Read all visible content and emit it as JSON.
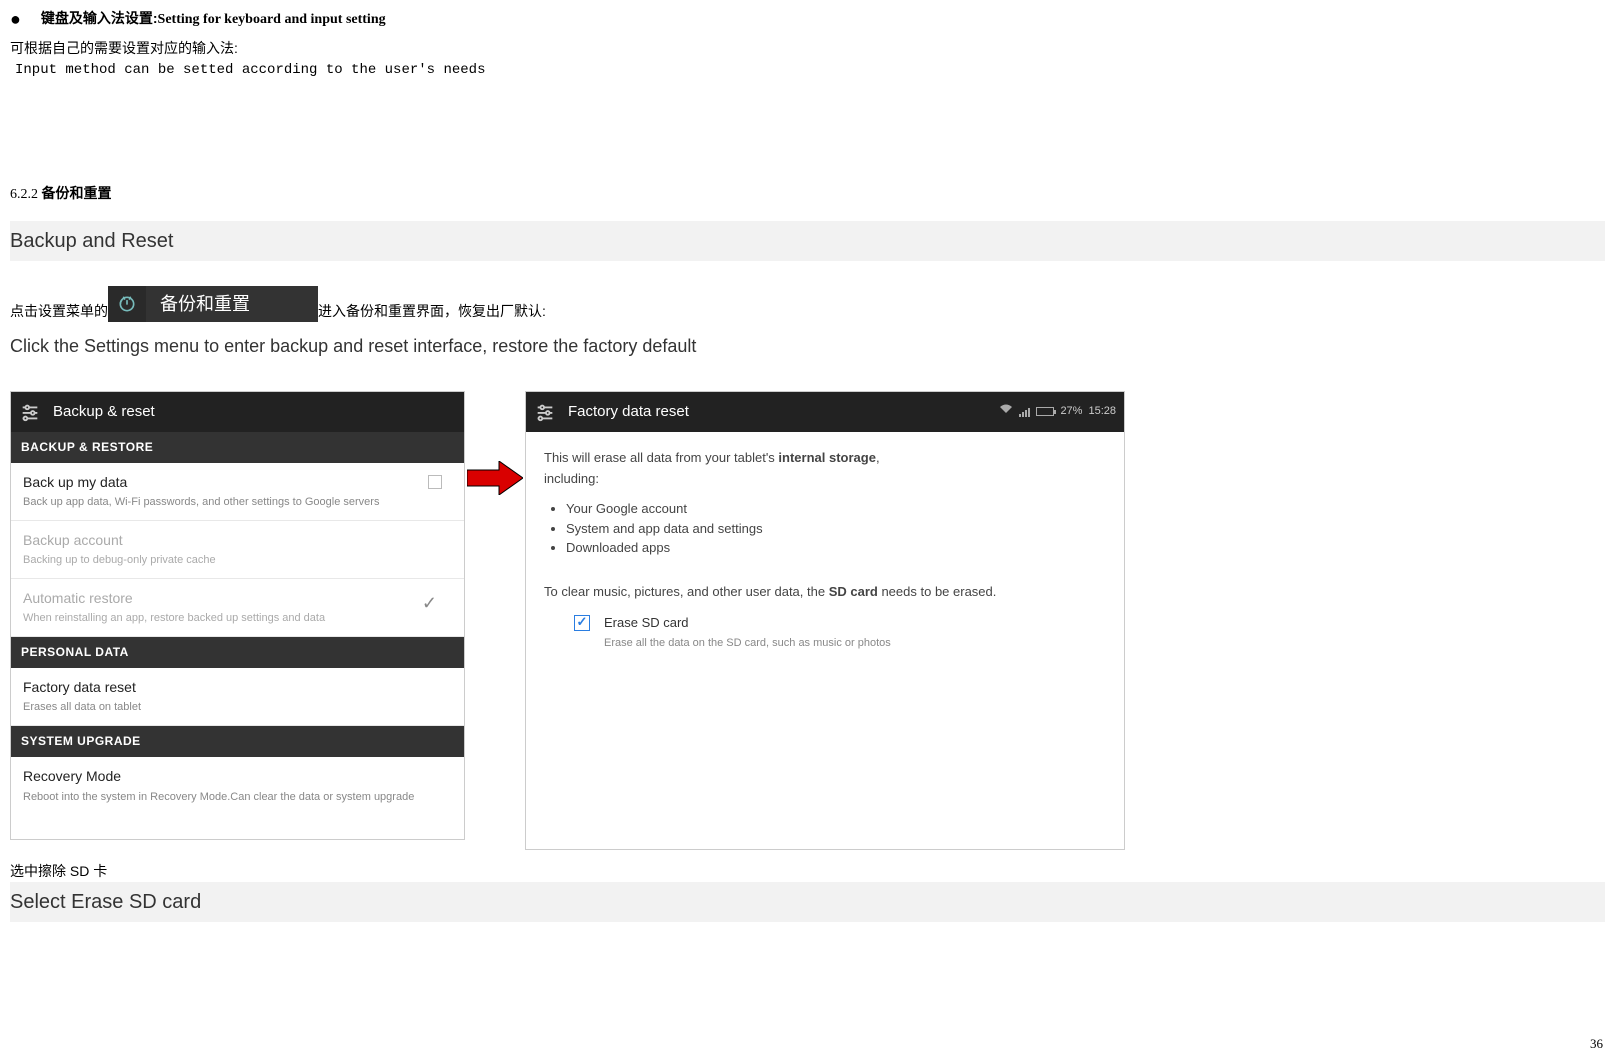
{
  "bullet_cn": "键盘及输入法设置:",
  "bullet_en": "Setting for keyboard and input setting",
  "line_cn1": "可根据自己的需要设置对应的输入法:",
  "line_mono": "Input method can be  setted  according to the user's needs",
  "section_num": "6.2.2 ",
  "section_cn": "备份和重置",
  "gray_bar1": "Backup and Reset",
  "inline_cn_before": "点击设置菜单的",
  "menu_badge_label": "备份和重置",
  "inline_cn_after": "进入备份和重置界面，恢复出厂默认:",
  "en_instruction": "Click the Settings menu to enter backup and reset interface, restore the factory default",
  "ss1": {
    "header": "Backup & reset",
    "sec1": "BACKUP & RESTORE",
    "item1_title": "Back up my data",
    "item1_sub": "Back up app data, Wi-Fi passwords, and other settings to Google servers",
    "item2_title": "Backup account",
    "item2_sub": "Backing up to debug-only private cache",
    "item3_title": "Automatic restore",
    "item3_sub": "When reinstalling an app, restore backed up settings and data",
    "sec2": "PERSONAL DATA",
    "item4_title": "Factory data reset",
    "item4_sub": "Erases all data on tablet",
    "sec3": "SYSTEM UPGRADE",
    "item5_title": "Recovery Mode",
    "item5_sub": "Reboot into the system in Recovery Mode.Can clear the data or system upgrade"
  },
  "ss2": {
    "header": "Factory data reset",
    "status_pct": "27%",
    "status_time": "15:28",
    "p1_a": "This will erase all data from your tablet's ",
    "p1_b": "internal storage",
    "p1_c": ",",
    "p1_d": "including:",
    "li1": "Your Google account",
    "li2": "System and app data and settings",
    "li3": "Downloaded apps",
    "p2_a": "To clear music, pictures, and other user data, the ",
    "p2_b": "SD card",
    "p2_c": " needs to be erased.",
    "erase_title": "Erase SD card",
    "erase_sub": "Erase all the data on the SD card, such as music or photos"
  },
  "bottom_cn": "选中擦除 SD 卡",
  "gray_bar2": "Select Erase SD card",
  "page_num": "36"
}
